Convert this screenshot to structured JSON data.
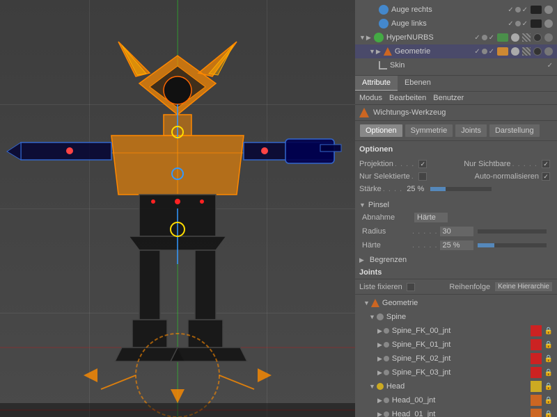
{
  "viewport": {
    "background": "#404040"
  },
  "scene_hierarchy": {
    "items": [
      {
        "label": "Auge rechts",
        "indent": 1,
        "icon": "blue-circle",
        "checked": true
      },
      {
        "label": "Auge links",
        "indent": 1,
        "icon": "blue-circle",
        "checked": true
      },
      {
        "label": "HyperNURBS",
        "indent": 0,
        "icon": "green-diamond",
        "checked": true
      },
      {
        "label": "Geometrie",
        "indent": 1,
        "icon": "orange-triangle",
        "checked": true
      },
      {
        "label": "Skin",
        "indent": 2,
        "icon": "curve",
        "checked": true
      }
    ]
  },
  "main_tabs": [
    {
      "label": "Attribute",
      "active": true
    },
    {
      "label": "Ebenen",
      "active": false
    }
  ],
  "menu_bar": [
    {
      "label": "Modus"
    },
    {
      "label": "Bearbeiten"
    },
    {
      "label": "Benutzer"
    }
  ],
  "tool_title": "Wichtungs-Werkzeug",
  "sub_tabs": [
    {
      "label": "Optionen",
      "active": true
    },
    {
      "label": "Symmetrie",
      "active": false
    },
    {
      "label": "Joints",
      "active": false
    },
    {
      "label": "Darstellung",
      "active": false
    }
  ],
  "options": {
    "section_title": "Optionen",
    "projektion_label": "Projektion",
    "projektion_checked": true,
    "nur_sichtbare_label": "Nur Sichtbare",
    "nur_sichtbare_checked": true,
    "nur_selektierte_label": "Nur Selektierte",
    "nur_selektierte_checked": false,
    "auto_normalisieren_label": "Auto-normalisieren",
    "auto_normalisieren_checked": true,
    "staerke_label": "Stärke",
    "staerke_value": "25 %",
    "staerke_slider_percent": 25
  },
  "pinsel": {
    "section_title": "Pinsel",
    "abnahme_label": "Abnahme",
    "abnahme_value": "Härte",
    "radius_label": "Radius",
    "radius_value": "30",
    "haerte_label": "Härte",
    "haerte_value": "25 %",
    "haerte_slider_percent": 25
  },
  "begrenzen": {
    "label": "Begrenzen"
  },
  "joints_section": {
    "title": "Joints",
    "liste_fixieren_label": "Liste fixieren",
    "reihenfolge_label": "Reihenfolge",
    "keine_hierarchie_label": "Keine Hierarchie",
    "tree": [
      {
        "label": "Geometrie",
        "indent": 0,
        "icon": "orange-triangle",
        "color": null,
        "level": 0
      },
      {
        "label": "Spine",
        "indent": 1,
        "icon": "joint",
        "color": null,
        "level": 1
      },
      {
        "label": "Spine_FK_00_jnt",
        "indent": 2,
        "icon": "joint-small",
        "color": "red",
        "level": 2
      },
      {
        "label": "Spine_FK_01_jnt",
        "indent": 2,
        "icon": "joint-small",
        "color": "red",
        "level": 2
      },
      {
        "label": "Spine_FK_02_jnt",
        "indent": 2,
        "icon": "joint-small",
        "color": "red",
        "level": 2
      },
      {
        "label": "Spine_FK_03_jnt",
        "indent": 2,
        "icon": "joint-small",
        "color": "red",
        "level": 2
      },
      {
        "label": "Head",
        "indent": 1,
        "icon": "joint",
        "color": "yellow",
        "level": 1
      },
      {
        "label": "Head_00_jnt",
        "indent": 2,
        "icon": "joint-small",
        "color": "orange",
        "level": 2
      },
      {
        "label": "Head_01_jnt",
        "indent": 2,
        "icon": "joint-small",
        "color": "orange",
        "level": 2
      }
    ]
  }
}
